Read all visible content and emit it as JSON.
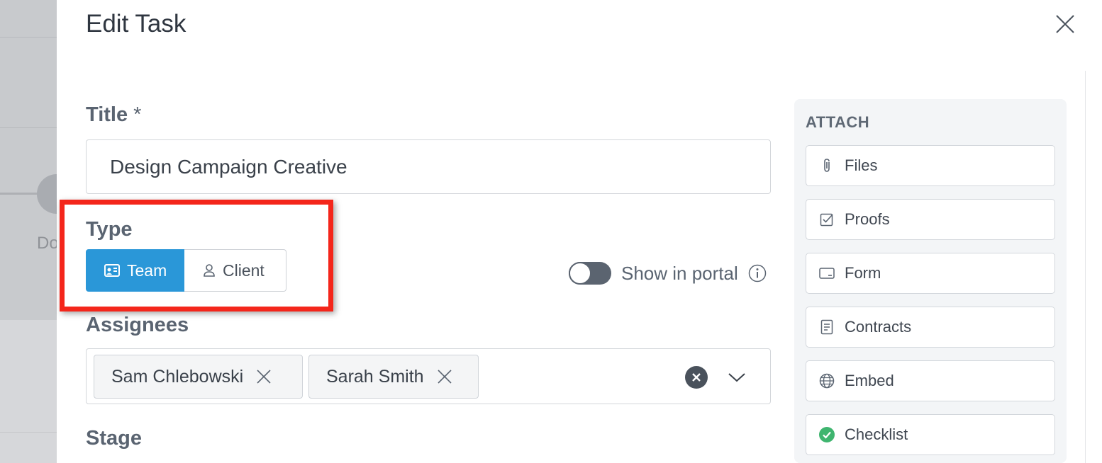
{
  "background": {
    "partial_text": "Do"
  },
  "modal": {
    "title": "Edit Task"
  },
  "title_field": {
    "label": "Title",
    "required_mark": "*",
    "value": "Design Campaign Creative"
  },
  "type_field": {
    "label": "Type",
    "options": [
      {
        "label": "Team",
        "icon": "team-card-icon",
        "selected": true
      },
      {
        "label": "Client",
        "icon": "person-icon",
        "selected": false
      }
    ]
  },
  "portal_toggle": {
    "label": "Show in portal",
    "enabled": false,
    "info_icon": "info-icon"
  },
  "assignees_field": {
    "label": "Assignees",
    "chips": [
      "Sam Chlebowski",
      "Sarah Smith"
    ]
  },
  "stage_field": {
    "label": "Stage"
  },
  "attach_panel": {
    "heading": "ATTACH",
    "items": [
      {
        "label": "Files",
        "icon": "paperclip-icon"
      },
      {
        "label": "Proofs",
        "icon": "checkbox-icon"
      },
      {
        "label": "Form",
        "icon": "form-icon"
      },
      {
        "label": "Contracts",
        "icon": "document-icon"
      },
      {
        "label": "Embed",
        "icon": "globe-icon"
      },
      {
        "label": "Checklist",
        "icon": "check-circle-icon"
      }
    ]
  },
  "colors": {
    "accent": "#2a97d8",
    "highlight": "#f4261b",
    "checklist_green": "#3fb56f"
  }
}
